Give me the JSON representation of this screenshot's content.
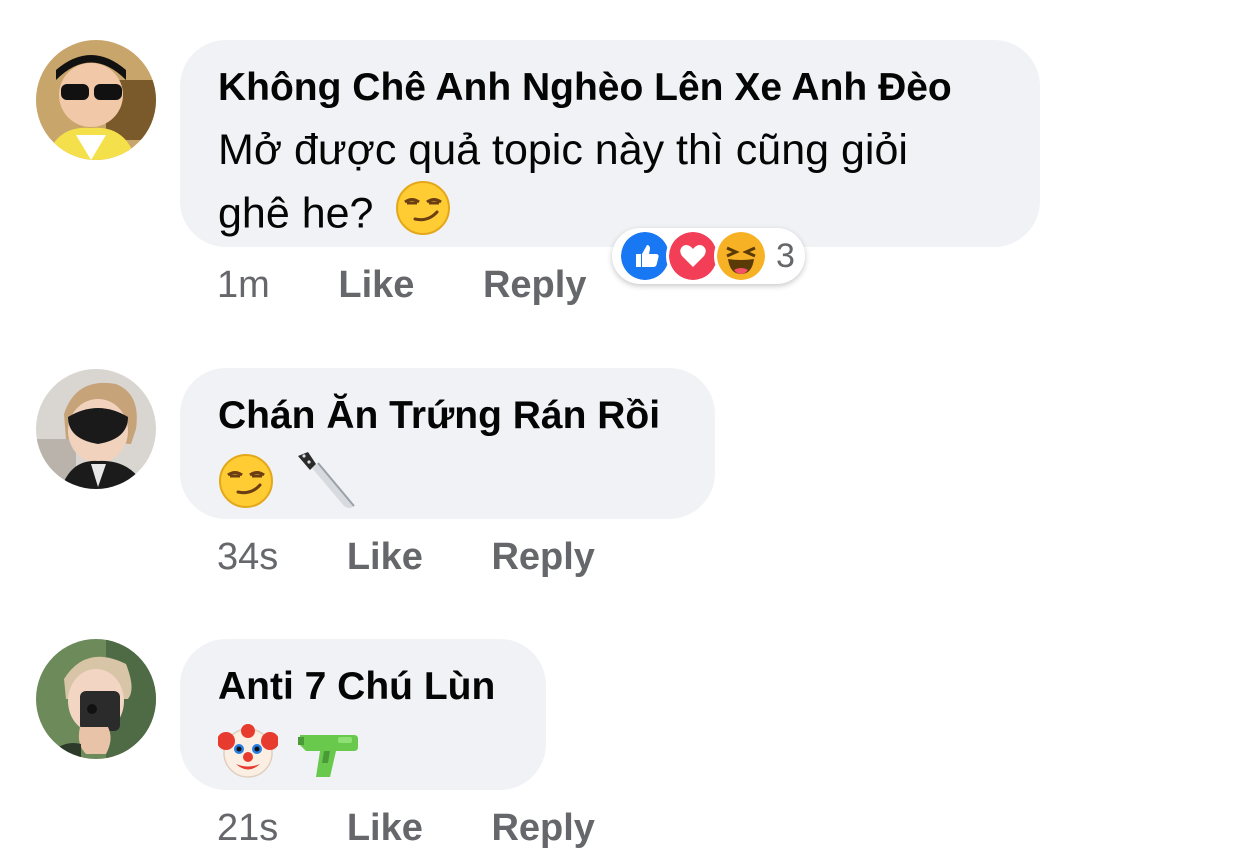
{
  "comments": [
    {
      "author": "Không Chê Anh Nghèo Lên Xe Anh Đèo",
      "text_line1": "Mở được quả topic này thì cũng giỏi",
      "text_line2": "ghê he?",
      "emojis": [
        "smirking-face"
      ],
      "time": "1m",
      "like": "Like",
      "reply": "Reply",
      "reactions": {
        "icons": [
          "like-icon",
          "love-icon",
          "haha-icon"
        ],
        "count": "3"
      }
    },
    {
      "author": "Chán Ăn Trứng Rán Rồi",
      "emojis": [
        "smirking-face",
        "kitchen-knife"
      ],
      "time": "34s",
      "like": "Like",
      "reply": "Reply"
    },
    {
      "author": "Anti 7 Chú Lùn",
      "emojis": [
        "clown-face",
        "water-pistol"
      ],
      "time": "21s",
      "like": "Like",
      "reply": "Reply"
    }
  ],
  "colors": {
    "bubble": "#f0f2f5",
    "meta_text": "#65676b",
    "like_blue": "#1877f2",
    "love_red": "#f33e58",
    "haha_yellow": "#f7b125"
  }
}
